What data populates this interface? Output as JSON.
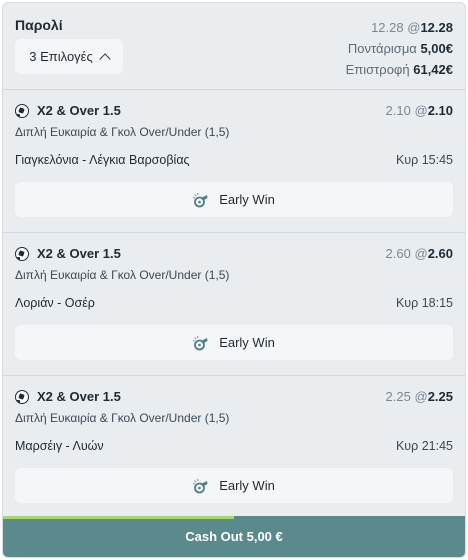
{
  "header": {
    "title": "Παρολί",
    "selections_button": "3 Επιλογές",
    "old_odds": "12.28",
    "at": "@",
    "new_odds": "12.28",
    "stake_label": "Ποντάρισμα",
    "stake_value": "5,00€",
    "return_label": "Επιστροφή",
    "return_value": "61,42€"
  },
  "selections": [
    {
      "icon": "soccer-ball-icon",
      "market": "X2 & Over 1.5",
      "old_odds": "2.10",
      "at": "@",
      "new_odds": "2.10",
      "description": "Διπλή Ευκαιρία & Γκολ Over/Under (1,5)",
      "match": "Γιαγκελόνια - Λέγκια Βαρσοβίας",
      "time": "Κυρ 15:45",
      "early_win": "Early Win"
    },
    {
      "icon": "soccer-ball-icon",
      "market": "X2 & Over 1.5",
      "old_odds": "2.60",
      "at": "@",
      "new_odds": "2.60",
      "description": "Διπλή Ευκαιρία & Γκολ Over/Under (1,5)",
      "match": "Λοριάν - Οσέρ",
      "time": "Κυρ 18:15",
      "early_win": "Early Win"
    },
    {
      "icon": "soccer-ball-icon",
      "market": "X2 & Over 1.5",
      "old_odds": "2.25",
      "at": "@",
      "new_odds": "2.25",
      "description": "Διπλή Ευκαιρία & Γκολ Over/Under (1,5)",
      "match": "Μαρσέιγ - Λυών",
      "time": "Κυρ 21:45",
      "early_win": "Early Win"
    }
  ],
  "cashout": {
    "label": "Cash Out 5,00 €",
    "progress": 0.5,
    "progress_color": "#a6d76b",
    "button_color": "#5b8a8d"
  },
  "colors": {
    "card_bg": "#e9edf0",
    "button_bg": "#f4f6f8",
    "text": "#1f2a33"
  }
}
